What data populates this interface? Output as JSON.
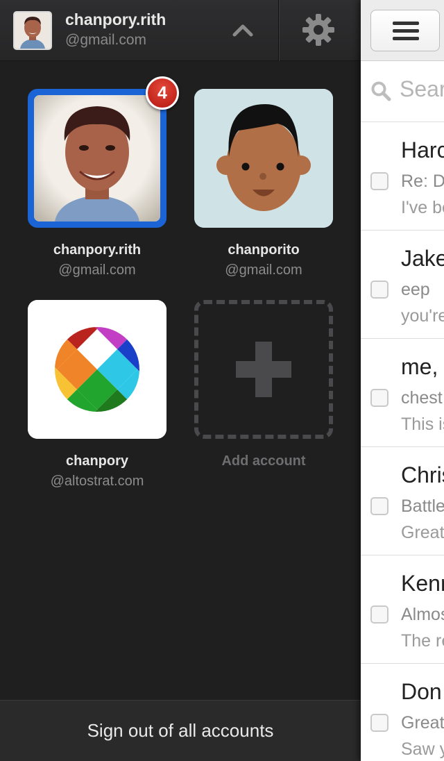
{
  "header": {
    "account_name": "chanpory.rith",
    "account_domain": "@gmail.com",
    "chevron_icon": "chevron-up-icon",
    "settings_icon": "gear-icon"
  },
  "accounts": [
    {
      "name": "chanpory.rith",
      "domain": "@gmail.com",
      "unread_badge": "4",
      "selected": true
    },
    {
      "name": "chanporito",
      "domain": "@gmail.com"
    },
    {
      "name": "chanpory",
      "domain": "@altostrat.com"
    }
  ],
  "add_account_label": "Add account",
  "sign_out_label": "Sign out of all accounts",
  "inbox": {
    "menu_icon": "hamburger-menu-icon",
    "search_placeholder": "Sear",
    "messages": [
      {
        "sender": "Harc",
        "subject": "Re: D",
        "snippet": "I've be"
      },
      {
        "sender": "Jake",
        "subject": "eep",
        "snippet": "you're"
      },
      {
        "sender": "me,",
        "subject": "chest",
        "snippet": "This is"
      },
      {
        "sender": "Chris",
        "subject": "Battle",
        "snippet": "Great"
      },
      {
        "sender": "Kenn",
        "subject": "Almos",
        "snippet": "The re"
      },
      {
        "sender": "Don",
        "subject": "Great",
        "snippet": "Saw y"
      }
    ]
  },
  "colors": {
    "drawer_bg": "#1f1f20",
    "selected_border": "#1a64d6",
    "badge_red": "#c8251a"
  }
}
